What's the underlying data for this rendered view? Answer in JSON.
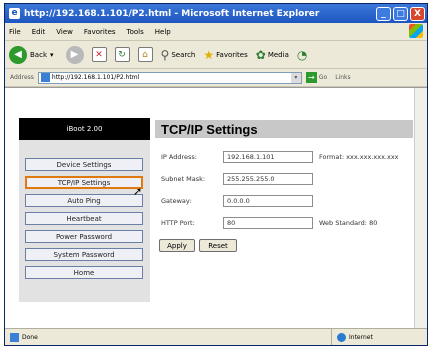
{
  "window": {
    "title": "http://192.168.1.101/P2.html - Microsoft Internet Explorer",
    "controls": [
      "_",
      "□",
      "X"
    ]
  },
  "menu": [
    "File",
    "Edit",
    "View",
    "Favorites",
    "Tools",
    "Help"
  ],
  "toolbar": {
    "back": "Back",
    "search": "Search",
    "favorites": "Favorites",
    "media": "Media"
  },
  "address": {
    "label": "Address",
    "url": "http://192.168.1.101/P2.html",
    "go": "Go",
    "links": "Links"
  },
  "sidebar": {
    "header": "iBoot 2.00",
    "items": [
      "Device Settings",
      "TCP/IP Settings",
      "Auto Ping",
      "Heartbeat",
      "Power Password",
      "System Password",
      "Home"
    ],
    "active_index": 1
  },
  "page": {
    "title": "TCP/IP Settings",
    "fields": [
      {
        "label": "IP Address:",
        "value": "192.168.1.101",
        "note": "Format: xxx.xxx.xxx.xxx"
      },
      {
        "label": "Subnet Mask:",
        "value": "255.255.255.0",
        "note": ""
      },
      {
        "label": "Gateway:",
        "value": "0.0.0.0",
        "note": ""
      },
      {
        "label": "HTTP Port:",
        "value": "80",
        "note": "Web Standard: 80"
      }
    ],
    "apply": "Apply",
    "reset": "Reset"
  },
  "status": {
    "left": "Done",
    "zone": "Internet"
  },
  "colors": {
    "titlebar": "#1d55c0",
    "active_border": "#e07a10",
    "sidebar_header": "#000000",
    "page_title_bg": "#c8c8c8"
  }
}
